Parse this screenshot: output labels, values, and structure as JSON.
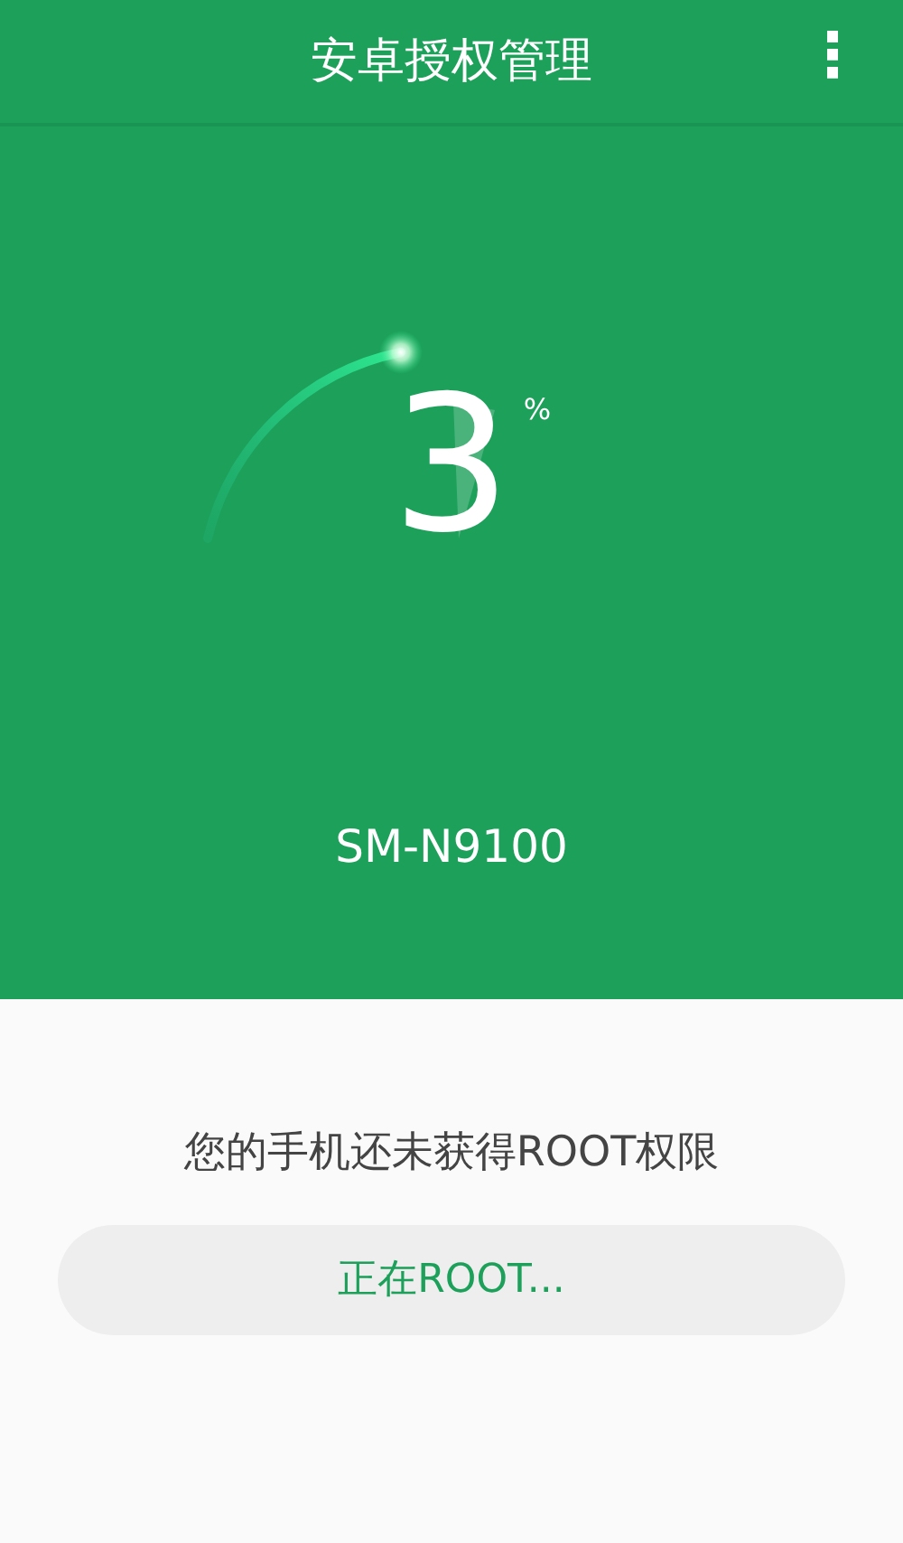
{
  "app_bar": {
    "title": "安卓授权管理",
    "menu_icon": "⋮"
  },
  "progress": {
    "percent": "3",
    "unit": "%"
  },
  "device": {
    "model": "SM-N9100"
  },
  "status": {
    "message": "您的手机还未获得ROOT权限"
  },
  "action_button": {
    "label": "正在ROOT...",
    "disabled": true
  }
}
